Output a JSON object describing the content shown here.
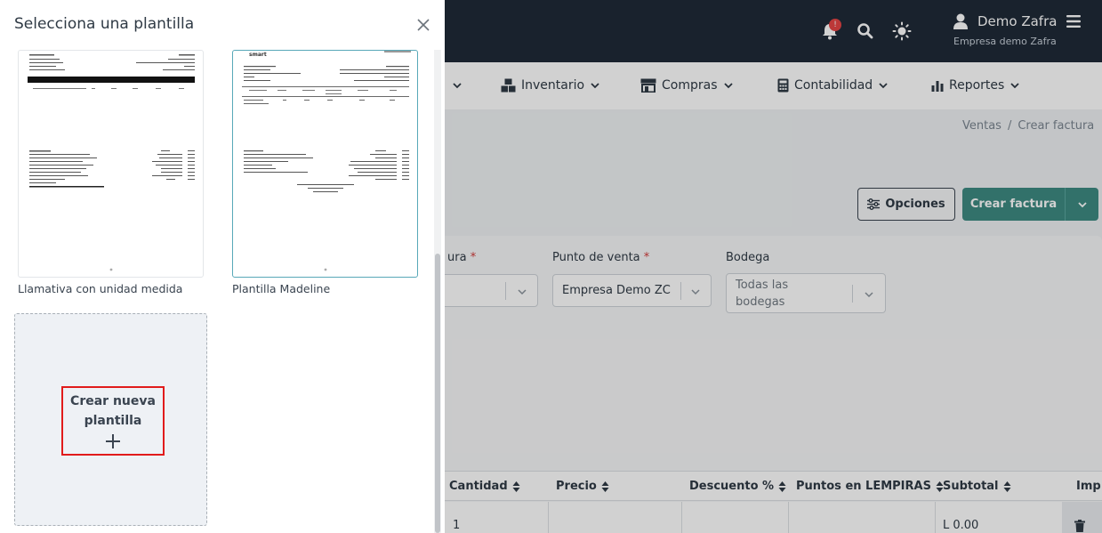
{
  "topbar": {
    "notification_count": "!",
    "user_name": "Demo Zafra",
    "company": "Empresa demo Zafra"
  },
  "menu": {
    "items": [
      {
        "label": "Inventario"
      },
      {
        "label": "Compras"
      },
      {
        "label": "Contabilidad"
      },
      {
        "label": "Reportes"
      }
    ]
  },
  "breadcrumb": {
    "parent": "Ventas",
    "separator": "/",
    "current": "Crear factura"
  },
  "actions": {
    "options_label": "Opciones",
    "create_label": "Crear factura"
  },
  "form": {
    "first_label_partial": "ura",
    "required_mark": "*",
    "point_of_sale_label": "Punto de venta",
    "point_of_sale_value": "Empresa Demo ZC",
    "warehouse_label": "Bodega",
    "warehouse_value_line1": "Todas las",
    "warehouse_value_line2": "bodegas"
  },
  "table": {
    "headers": [
      "Cantidad",
      "Precio",
      "Descuento %",
      "Puntos en LEMPIRAS",
      "Subtotal",
      "Imp"
    ],
    "row": {
      "cantidad": "1",
      "subtotal": "L 0.00"
    }
  },
  "modal": {
    "title": "Selecciona una plantilla",
    "templates": [
      {
        "name": "Llamativa con unidad medida",
        "selected": false
      },
      {
        "name": "Plantilla Madeline",
        "selected": true,
        "logo_text": "smart"
      }
    ],
    "new_template_label": "Crear nueva plantilla"
  },
  "colors": {
    "topbar": "#1f2a38",
    "accent": "#3d8a82",
    "highlight": "#e11b1b"
  }
}
